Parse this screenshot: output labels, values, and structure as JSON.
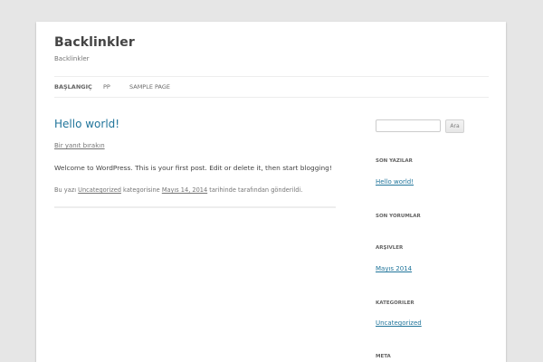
{
  "site": {
    "title": "Backlinkler",
    "description": "Backlinkler"
  },
  "nav": {
    "items": [
      {
        "label": "BAŞLANGIÇ",
        "current": true
      },
      {
        "label": "PP",
        "current": false
      },
      {
        "label": "SAMPLE PAGE",
        "current": false
      }
    ]
  },
  "post": {
    "title": "Hello world!",
    "reply_link": "Bir yanıt bırakın",
    "content": "Welcome to WordPress. This is your first post. Edit or delete it, then start blogging!",
    "meta": {
      "prefix": "Bu yazı",
      "category": "Uncategorized",
      "middle": "kategorisine",
      "date": "Mayıs 14, 2014",
      "suffix": "tarihinde tarafından gönderildi."
    }
  },
  "sidebar": {
    "search": {
      "value": "",
      "button_label": "Ara"
    },
    "recent_posts": {
      "title": "SON YAZILAR",
      "items": [
        "Hello world!"
      ]
    },
    "recent_comments": {
      "title": "SON YORUMLAR"
    },
    "archives": {
      "title": "ARŞIVLER",
      "items": [
        "Mayıs 2014"
      ]
    },
    "categories": {
      "title": "KATEGORILER",
      "items": [
        "Uncategorized"
      ]
    },
    "meta": {
      "title": "META"
    }
  },
  "colors": {
    "link": "#21759b",
    "background": "#e6e6e6",
    "page": "#ffffff"
  }
}
